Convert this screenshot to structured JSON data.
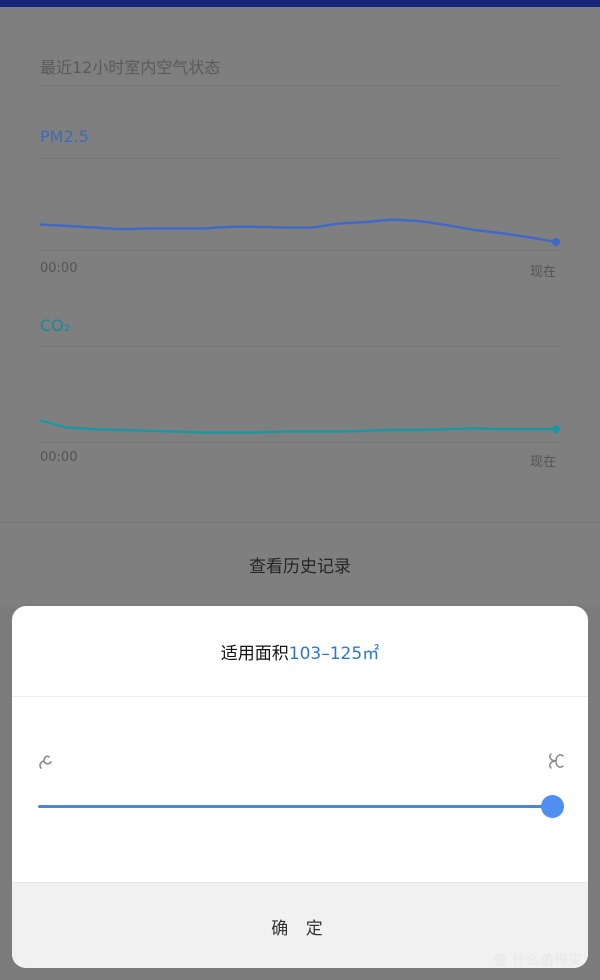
{
  "background": {
    "section_title": "最近12小时室内空气状态",
    "pm_chart": {
      "label": "PM2.5",
      "color": "#3f69c8",
      "x_start_label": "00:00",
      "x_end_label": "现在",
      "points": [
        0.27,
        0.25,
        0.23,
        0.21,
        0.22,
        0.22,
        0.22,
        0.24,
        0.24,
        0.23,
        0.23,
        0.28,
        0.3,
        0.33,
        0.31,
        0.26,
        0.2,
        0.16,
        0.11,
        0.05
      ]
    },
    "co2_chart": {
      "label": "CO₂",
      "color": "#1898a7",
      "x_start_label": "00:00",
      "x_end_label": "现在",
      "points": [
        0.17,
        0.08,
        0.06,
        0.05,
        0.04,
        0.03,
        0.02,
        0.02,
        0.02,
        0.03,
        0.03,
        0.03,
        0.04,
        0.05,
        0.05,
        0.06,
        0.07,
        0.06,
        0.06,
        0.06
      ]
    },
    "history_button": "查看历史记录"
  },
  "dialog": {
    "title_prefix": "适用面积",
    "title_value": "103–125㎡",
    "slider": {
      "min_icon": "fan-small-icon",
      "max_icon": "fan-large-icon",
      "value_percent": 100
    },
    "confirm_button": "确 定"
  },
  "watermark": "值 什么值得买",
  "colors": {
    "accent": "#4f8ff0",
    "topbar": "#16247a"
  }
}
